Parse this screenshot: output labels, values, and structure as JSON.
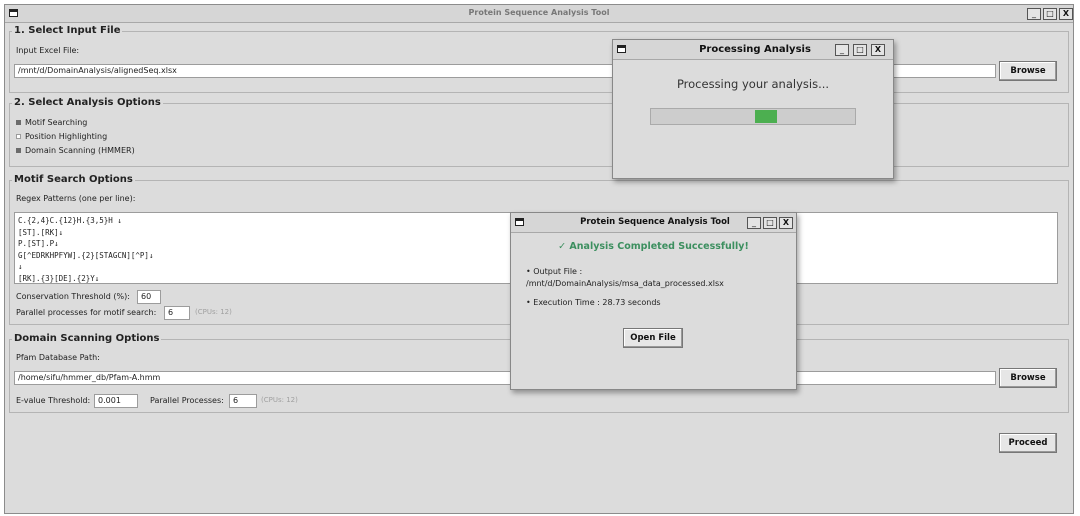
{
  "main_window": {
    "title": "Protein Sequence Analysis Tool",
    "controls": {
      "minimize": "_",
      "maximize": "□",
      "close": "X"
    }
  },
  "input_section": {
    "title": "1. Select Input File",
    "file_label": "Input Excel File:",
    "file_value": "/mnt/d/DomainAnalysis/alignedSeq.xlsx",
    "browse_label": "Browse"
  },
  "options_section": {
    "title": "2. Select Analysis Options",
    "options": [
      {
        "label": "Motif Searching",
        "checked": true
      },
      {
        "label": "Position Highlighting",
        "checked": false
      },
      {
        "label": "Domain Scanning (HMMER)",
        "checked": true
      }
    ]
  },
  "motif_section": {
    "title": "Motif Search Options",
    "patterns_label": "Regex Patterns (one per line):",
    "patterns": [
      "C.{2,4}C.{12}H.{3,5}H ↓",
      "[ST].[RK]↓",
      "P.[ST].P↓",
      "G[^EDRKHPFYW].{2}[STAGCN][^P]↓",
      "↓",
      "[RK].{3}[DE].{2}Y↓"
    ],
    "conservation_label": "Conservation Threshold (%):",
    "conservation_value": "60",
    "parallel_label": "Parallel processes for motif search:",
    "parallel_value": "6",
    "cpus_hint": "(CPUs: 12)"
  },
  "domain_section": {
    "title": "Domain Scanning Options",
    "pfam_label": "Pfam Database Path:",
    "pfam_value": "/home/sifu/hmmer_db/Pfam-A.hmm",
    "browse_label": "Browse",
    "evalue_label": "E-value Threshold:",
    "evalue_value": "0.001",
    "parallel_label": "Parallel Processes:",
    "parallel_value": "6",
    "cpus_hint": "(CPUs: 12)"
  },
  "proceed_label": "Proceed",
  "processing_dialog": {
    "title": "Processing Analysis",
    "message": "Processing your analysis...",
    "progress_color": "#4caf50",
    "progress_bar_fill_color": "#4caf50"
  },
  "result_dialog": {
    "title": "Protein Sequence Analysis Tool",
    "success_message": "✓ Analysis Completed Successfully!",
    "success_color": "#3c8f5f",
    "output_label": "• Output File :",
    "output_path": "/mnt/d/DomainAnalysis/msa_data_processed.xlsx",
    "execution_time": "• Execution Time : 28.73 seconds",
    "open_file_label": "Open File"
  }
}
